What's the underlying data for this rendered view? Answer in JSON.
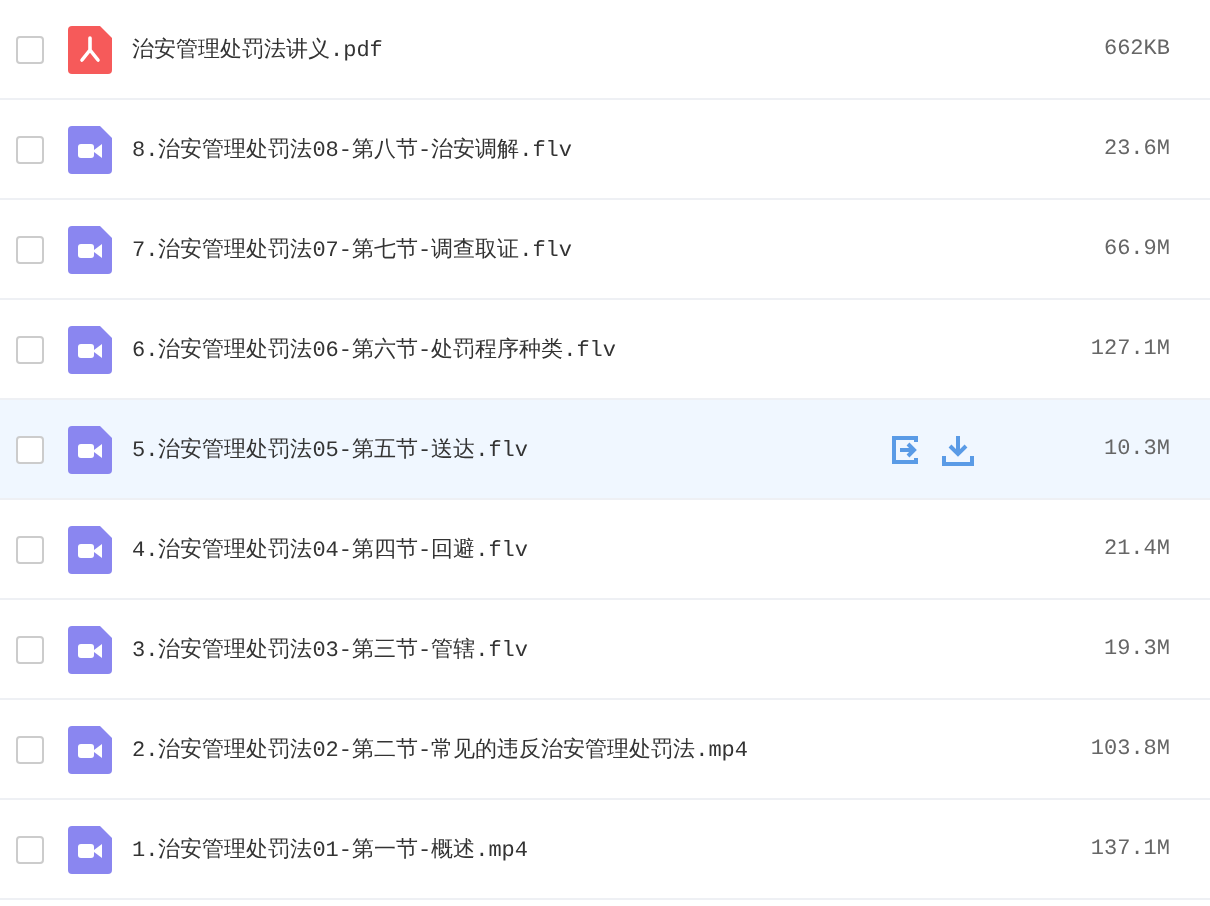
{
  "files": [
    {
      "kind": "pdf",
      "name": "治安管理处罚法讲义.pdf",
      "size": "662KB",
      "hovered": false,
      "checked": false
    },
    {
      "kind": "video",
      "name": "8.治安管理处罚法08-第八节-治安调解.flv",
      "size": "23.6M",
      "hovered": false,
      "checked": false
    },
    {
      "kind": "video",
      "name": "7.治安管理处罚法07-第七节-调查取证.flv",
      "size": "66.9M",
      "hovered": false,
      "checked": false
    },
    {
      "kind": "video",
      "name": "6.治安管理处罚法06-第六节-处罚程序种类.flv",
      "size": "127.1M",
      "hovered": false,
      "checked": false
    },
    {
      "kind": "video",
      "name": "5.治安管理处罚法05-第五节-送达.flv",
      "size": "10.3M",
      "hovered": true,
      "checked": false
    },
    {
      "kind": "video",
      "name": "4.治安管理处罚法04-第四节-回避.flv",
      "size": "21.4M",
      "hovered": false,
      "checked": false
    },
    {
      "kind": "video",
      "name": "3.治安管理处罚法03-第三节-管辖.flv",
      "size": "19.3M",
      "hovered": false,
      "checked": false
    },
    {
      "kind": "video",
      "name": "2.治安管理处罚法02-第二节-常见的违反治安管理处罚法.mp4",
      "size": "103.8M",
      "hovered": false,
      "checked": false
    },
    {
      "kind": "video",
      "name": "1.治安管理处罚法01-第一节-概述.mp4",
      "size": "137.1M",
      "hovered": false,
      "checked": false
    }
  ]
}
